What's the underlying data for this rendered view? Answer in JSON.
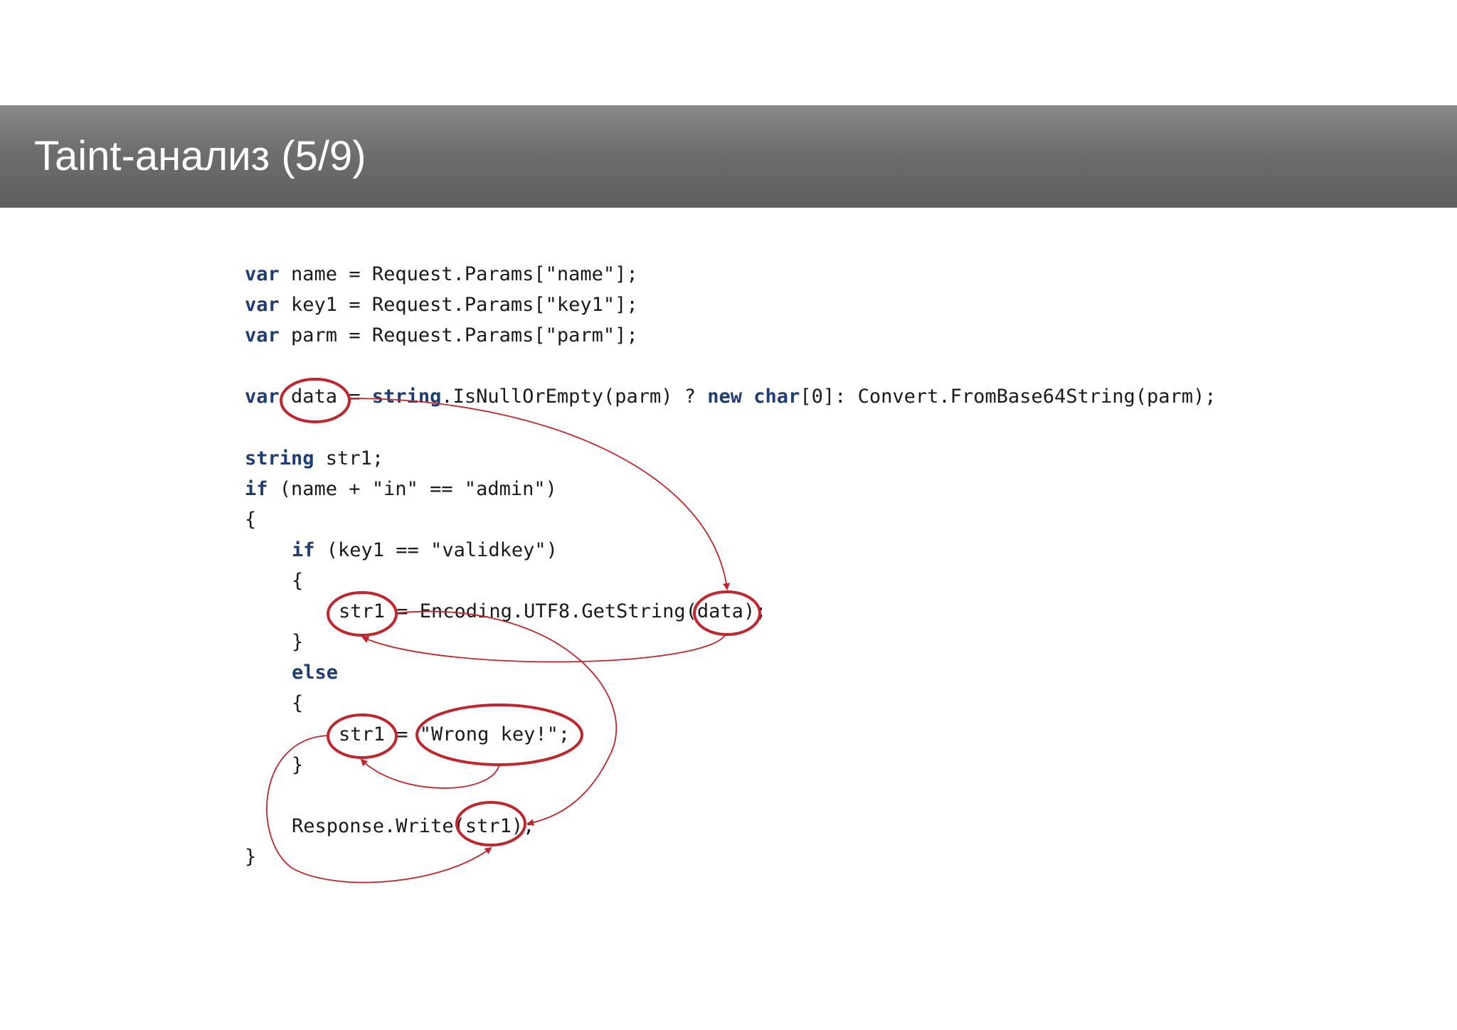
{
  "slide": {
    "title": "Taint-анализ (5/9)"
  },
  "code": {
    "lines": [
      {
        "indent": 0,
        "tokens": [
          {
            "t": "var",
            "kw": true
          },
          {
            "t": " name = Request.Params[\"name\"];"
          }
        ]
      },
      {
        "indent": 0,
        "tokens": [
          {
            "t": "var",
            "kw": true
          },
          {
            "t": " key1 = Request.Params[\"key1\"];"
          }
        ]
      },
      {
        "indent": 0,
        "tokens": [
          {
            "t": "var",
            "kw": true
          },
          {
            "t": " parm = Request.Params[\"parm\"];"
          }
        ]
      },
      {
        "indent": 0,
        "tokens": []
      },
      {
        "indent": 0,
        "tokens": [
          {
            "t": "var",
            "kw": true
          },
          {
            "t": " data = "
          },
          {
            "t": "string",
            "kw": true
          },
          {
            "t": ".IsNullOrEmpty(parm) ? "
          },
          {
            "t": "new",
            "kw": true
          },
          {
            "t": " "
          },
          {
            "t": "char",
            "kw": true
          },
          {
            "t": "[0]: Convert.FromBase64String(parm);"
          }
        ]
      },
      {
        "indent": 0,
        "tokens": []
      },
      {
        "indent": 0,
        "tokens": [
          {
            "t": "string",
            "kw": true
          },
          {
            "t": " str1;"
          }
        ]
      },
      {
        "indent": 0,
        "tokens": [
          {
            "t": "if",
            "kw": true
          },
          {
            "t": " (name + \"in\" == \"admin\")"
          }
        ]
      },
      {
        "indent": 0,
        "tokens": [
          {
            "t": "{"
          }
        ]
      },
      {
        "indent": 1,
        "tokens": [
          {
            "t": "if",
            "kw": true
          },
          {
            "t": " (key1 == \"validkey\")"
          }
        ]
      },
      {
        "indent": 1,
        "tokens": [
          {
            "t": "{"
          }
        ]
      },
      {
        "indent": 2,
        "tokens": [
          {
            "t": "str1 = Encoding.UTF8.GetString(data);"
          }
        ]
      },
      {
        "indent": 1,
        "tokens": [
          {
            "t": "}"
          }
        ]
      },
      {
        "indent": 1,
        "tokens": [
          {
            "t": "else",
            "kw": true
          }
        ]
      },
      {
        "indent": 1,
        "tokens": [
          {
            "t": "{"
          }
        ]
      },
      {
        "indent": 2,
        "tokens": [
          {
            "t": "str1 = \"Wrong key!\";"
          }
        ]
      },
      {
        "indent": 1,
        "tokens": [
          {
            "t": "}"
          }
        ]
      },
      {
        "indent": 0,
        "tokens": []
      },
      {
        "indent": 1,
        "tokens": [
          {
            "t": "Response.Write(str1);"
          }
        ]
      },
      {
        "indent": 0,
        "tokens": [
          {
            "t": "}"
          }
        ]
      }
    ]
  },
  "annotation_color": "#c0262e"
}
